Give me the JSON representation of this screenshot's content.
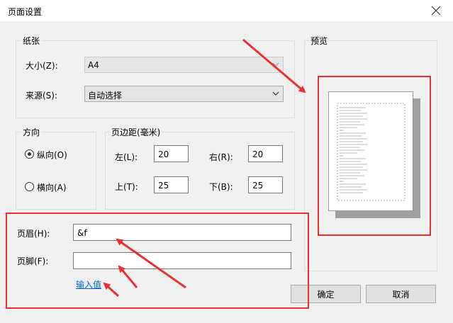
{
  "window": {
    "title": "页面设置"
  },
  "paper": {
    "group_label": "纸张",
    "size_label": "大小(Z):",
    "size_value": "A4",
    "source_label": "来源(S):",
    "source_value": "自动选择"
  },
  "orientation": {
    "group_label": "方向",
    "portrait_label": "纵向(O)",
    "landscape_label": "横向(A)",
    "selected": "portrait"
  },
  "margins": {
    "group_label": "页边距(毫米)",
    "left_label": "左(L):",
    "left_value": "20",
    "right_label": "右(R):",
    "right_value": "20",
    "top_label": "上(T):",
    "top_value": "25",
    "bottom_label": "下(B):",
    "bottom_value": "25"
  },
  "header_footer": {
    "header_label": "页眉(H):",
    "header_value": "&f",
    "footer_label": "页脚(F):",
    "footer_value": "",
    "input_link": "输入值"
  },
  "preview": {
    "group_label": "预览"
  },
  "buttons": {
    "ok": "确定",
    "cancel": "取消"
  },
  "colors": {
    "annotation": "#e8302e",
    "link": "#0066cc"
  }
}
